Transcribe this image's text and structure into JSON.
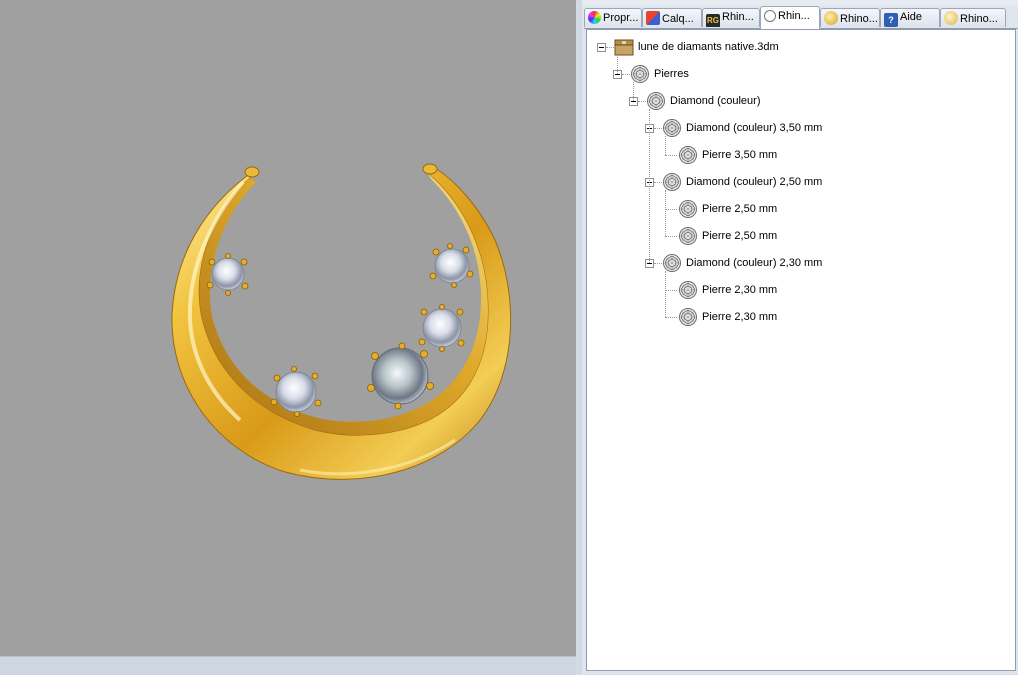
{
  "tabs": [
    {
      "label": "Propr...",
      "icon": "color-wheel-icon",
      "active": false
    },
    {
      "label": "Calq...",
      "icon": "layers-icon",
      "active": false
    },
    {
      "label": "Rhin...",
      "icon": "rhinogold-icon",
      "active": false
    },
    {
      "label": "Rhin...",
      "icon": "clock-icon",
      "active": true
    },
    {
      "label": "Rhino...",
      "icon": "render-icon",
      "active": false
    },
    {
      "label": "Aide",
      "icon": "help-icon",
      "active": false
    },
    {
      "label": "Rhino...",
      "icon": "material-icon",
      "active": false
    }
  ],
  "tree": {
    "root": "lune de diamants native.3dm",
    "group": "Pierres",
    "category": "Diamond (couleur)",
    "sizes": [
      {
        "label": "Diamond (couleur) 3,50 mm",
        "items": [
          "Pierre 3,50 mm"
        ]
      },
      {
        "label": "Diamond (couleur) 2,50 mm",
        "items": [
          "Pierre 2,50 mm",
          "Pierre 2,50 mm"
        ]
      },
      {
        "label": "Diamond (couleur) 2,30 mm",
        "items": [
          "Pierre 2,30 mm",
          "Pierre 2,30 mm"
        ]
      }
    ]
  },
  "viewport": {
    "background": "#a0a0a0",
    "object": "gold crescent moon pendant with diamonds",
    "gold": "#e0a824",
    "stones": 5
  }
}
